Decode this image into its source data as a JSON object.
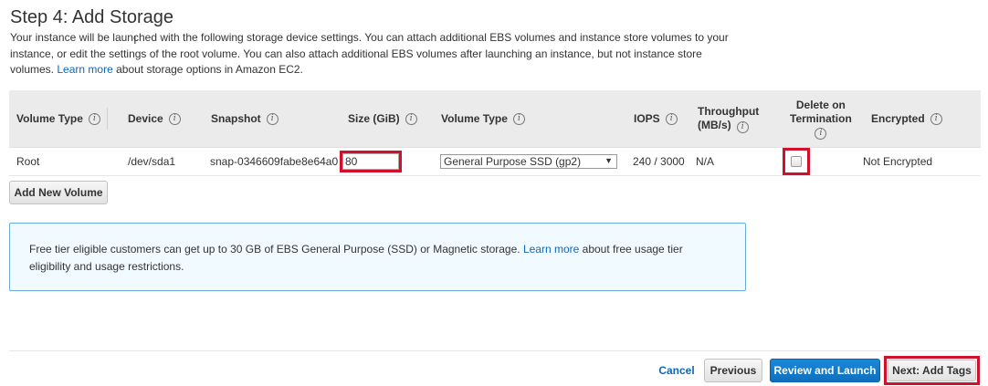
{
  "header": {
    "title": "Step 4: Add Storage",
    "intro_text": "Your instance will be launched with the following storage device settings. You can attach additional EBS volumes and instance store volumes to your instance, or edit the settings of the root volume. You can also attach additional EBS volumes after launching an instance, but not instance store volumes.",
    "learn_more": "Learn more",
    "intro_suffix": "about storage options in Amazon EC2."
  },
  "table": {
    "columns": {
      "volume_type": "Volume Type",
      "device": "Device",
      "snapshot": "Snapshot",
      "size": "Size (GiB)",
      "volume_type2": "Volume Type",
      "iops": "IOPS",
      "throughput_line1": "Throughput",
      "throughput_line2": "(MB/s)",
      "delete_line1": "Delete on",
      "delete_line2": "Termination",
      "encrypted": "Encrypted"
    },
    "rows": [
      {
        "volume_type": "Root",
        "device": "/dev/sda1",
        "snapshot": "snap-0346609fabe8e64a0",
        "size": "80",
        "ebs_type": "General Purpose SSD (gp2)",
        "iops": "240 / 3000",
        "throughput": "N/A",
        "delete_on_termination": false,
        "encrypted": "Not Encrypted"
      }
    ]
  },
  "add_volume_label": "Add New Volume",
  "free_tier": {
    "text": "Free tier eligible customers can get up to 30 GB of EBS General Purpose (SSD) or Magnetic storage.",
    "learn_more": "Learn more",
    "suffix": "about free usage tier eligibility and usage restrictions."
  },
  "footer": {
    "cancel": "Cancel",
    "previous": "Previous",
    "review_launch": "Review and Launch",
    "next": "Next: Add Tags"
  },
  "icons": {
    "info": "info-icon",
    "dropdown": "chevron-down-icon"
  },
  "colors": {
    "link": "#1166bb",
    "primary_button": "#1a88d9",
    "highlight": "#d0112b",
    "info_border": "#6aaed6"
  }
}
